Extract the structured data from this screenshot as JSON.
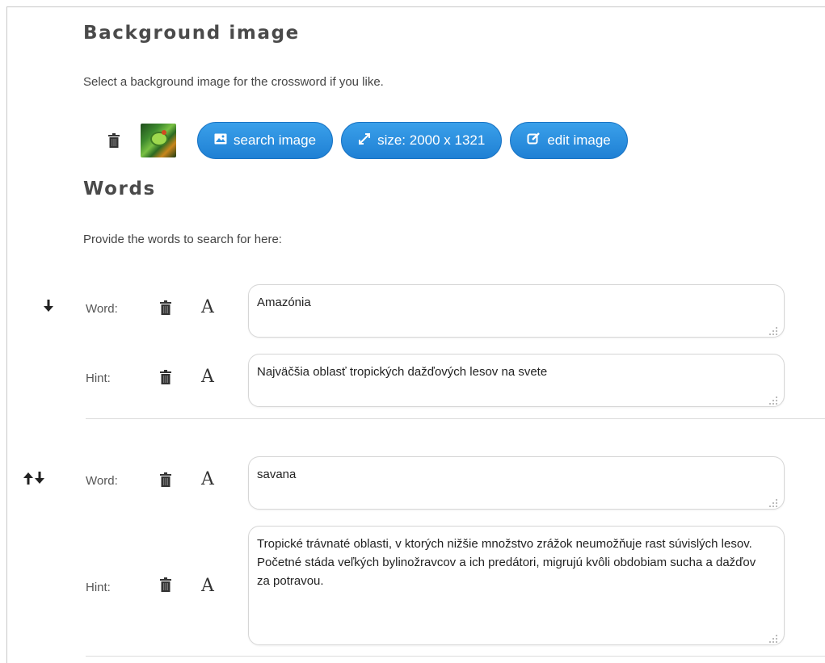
{
  "background": {
    "title": "Background image",
    "description": "Select a background image for the crossword if you like.",
    "buttons": {
      "search": "search image",
      "size": "size: 2000 x 1321",
      "edit": "edit image"
    },
    "icons": [
      "trash-icon",
      "image-thumbnail",
      "picture-icon",
      "resize-icon",
      "edit-icon"
    ]
  },
  "words": {
    "title": "Words",
    "description": "Provide the words to search for here:",
    "word_label": "Word:",
    "hint_label": "Hint:",
    "format_glyph": "A",
    "entries": [
      {
        "word": "Amazónia",
        "hint": "Najväčšia oblasť tropických dažďových lesov na svete",
        "controls": [
          "arrow-down-icon"
        ]
      },
      {
        "word": "savana",
        "hint": "Tropické trávnaté oblasti, v ktorých nižšie množstvo zrážok neumožňuje rast súvislých lesov. Početné stáda veľkých bylinožravcov a ich predátori, migrujú kvôli obdobiam sucha a dažďov za potravou.",
        "controls": [
          "arrow-up-icon",
          "arrow-down-icon"
        ]
      }
    ]
  },
  "colors": {
    "button": "#2a8fe0",
    "heading": "#4a4a4a",
    "border": "#d6d6d6"
  }
}
